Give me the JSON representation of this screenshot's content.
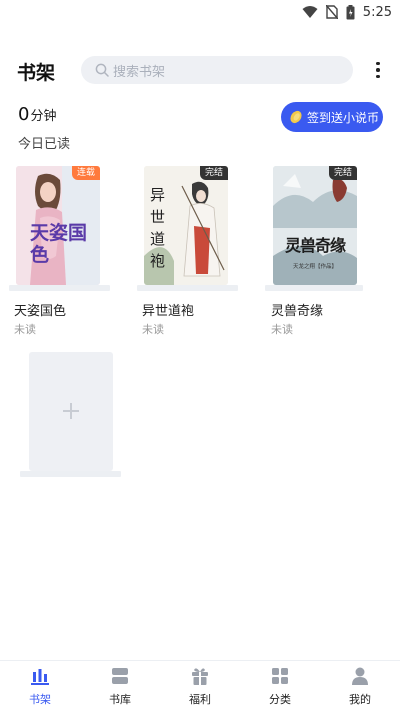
{
  "status_bar": {
    "time": "5:25"
  },
  "header": {
    "title": "书架",
    "search_placeholder": "搜索书架"
  },
  "reading": {
    "minutes": "0",
    "unit": "分钟",
    "label": "今日已读"
  },
  "checkin": {
    "label": "签到送小说币"
  },
  "books": [
    {
      "title": "天姿国色",
      "status": "未读",
      "badge": "连载",
      "cover_text": "天姿国色",
      "badge_color": "#ff7a3d"
    },
    {
      "title": "异世道袍",
      "status": "未读",
      "badge": "完结",
      "cover_text": "异世道袍",
      "badge_color": "#333333"
    },
    {
      "title": "灵兽奇缘",
      "status": "未读",
      "badge": "完结",
      "cover_text": "灵兽奇缘",
      "cover_subtext": "天龙之翔【作品】",
      "badge_color": "#333333"
    }
  ],
  "tabs": [
    {
      "label": "书架",
      "icon": "bookshelf-icon",
      "active": true
    },
    {
      "label": "书库",
      "icon": "library-icon"
    },
    {
      "label": "福利",
      "icon": "gift-icon"
    },
    {
      "label": "分类",
      "icon": "category-icon"
    },
    {
      "label": "我的",
      "icon": "profile-icon"
    }
  ],
  "colors": {
    "accent": "#3a5af0",
    "search_bg": "#eef0f4"
  }
}
